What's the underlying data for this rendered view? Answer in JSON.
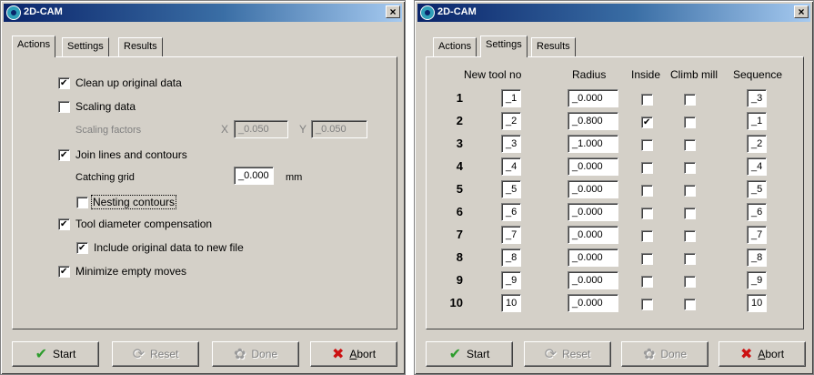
{
  "left": {
    "title": "2D-CAM",
    "close": "×",
    "tabs": [
      "Actions",
      "Settings",
      "Results"
    ],
    "options": {
      "clean_up": "Clean up original data",
      "scaling": "Scaling data",
      "scaling_factors": "Scaling factors",
      "x_label": "X",
      "x_value": "_0.050",
      "y_label": "Y",
      "y_value": "_0.050",
      "join": "Join lines and contours",
      "catching_grid": "Catching grid",
      "catching_value": "_0.000",
      "unit": "mm",
      "nesting": "Nesting contours",
      "tool_comp": "Tool diameter compensation",
      "include_original": "Include original data to new file",
      "minimize": "Minimize empty moves"
    },
    "checked": {
      "clean_up": true,
      "scaling": false,
      "join": true,
      "nesting": false,
      "tool_comp": true,
      "include_original": true,
      "minimize": true
    },
    "buttons": {
      "start": "Start",
      "reset": "Reset",
      "done": "Done",
      "abort_pre": "",
      "abort_u": "A",
      "abort_post": "bort"
    }
  },
  "right": {
    "title": "2D-CAM",
    "close": "×",
    "tabs": [
      "Actions",
      "Settings",
      "Results"
    ],
    "headers": {
      "tool": "New tool no",
      "radius": "Radius",
      "inside": "Inside",
      "climb": "Climb mill",
      "sequence": "Sequence"
    },
    "rows": [
      {
        "n": "1",
        "tool": "_1",
        "radius": "_0.000",
        "inside": false,
        "climb": false,
        "seq": "_3"
      },
      {
        "n": "2",
        "tool": "_2",
        "radius": "_0.800",
        "inside": true,
        "climb": false,
        "seq": "_1"
      },
      {
        "n": "3",
        "tool": "_3",
        "radius": "_1.000",
        "inside": false,
        "climb": false,
        "seq": "_2"
      },
      {
        "n": "4",
        "tool": "_4",
        "radius": "_0.000",
        "inside": false,
        "climb": false,
        "seq": "_4"
      },
      {
        "n": "5",
        "tool": "_5",
        "radius": "_0.000",
        "inside": false,
        "climb": false,
        "seq": "_5"
      },
      {
        "n": "6",
        "tool": "_6",
        "radius": "_0.000",
        "inside": false,
        "climb": false,
        "seq": "_6"
      },
      {
        "n": "7",
        "tool": "_7",
        "radius": "_0.000",
        "inside": false,
        "climb": false,
        "seq": "_7"
      },
      {
        "n": "8",
        "tool": "_8",
        "radius": "_0.000",
        "inside": false,
        "climb": false,
        "seq": "_8"
      },
      {
        "n": "9",
        "tool": "_9",
        "radius": "_0.000",
        "inside": false,
        "climb": false,
        "seq": "_9"
      },
      {
        "n": "10",
        "tool": "10",
        "radius": "_0.000",
        "inside": false,
        "climb": false,
        "seq": "10"
      }
    ],
    "buttons": {
      "start": "Start",
      "reset": "Reset",
      "done": "Done",
      "abort_pre": "",
      "abort_u": "A",
      "abort_post": "bort"
    }
  }
}
